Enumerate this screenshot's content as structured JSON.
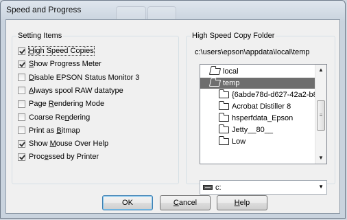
{
  "window": {
    "title": "Speed and Progress"
  },
  "settings": {
    "legend": "Setting Items",
    "items": [
      {
        "pre": "",
        "key": "H",
        "post": "igh Speed Copies",
        "checked": true,
        "focused": true
      },
      {
        "pre": "",
        "key": "S",
        "post": "how Progress Meter",
        "checked": true
      },
      {
        "pre": "",
        "key": "D",
        "post": "isable EPSON Status Monitor 3",
        "checked": false
      },
      {
        "pre": "",
        "key": "A",
        "post": "lways spool RAW datatype",
        "checked": false
      },
      {
        "pre": "Page ",
        "key": "R",
        "post": "endering Mode",
        "checked": false
      },
      {
        "pre": "Coarse Re",
        "key": "n",
        "post": "dering",
        "checked": false
      },
      {
        "pre": "Print as ",
        "key": "B",
        "post": "itmap",
        "checked": false
      },
      {
        "pre": "Show ",
        "key": "M",
        "post": "ouse Over Help",
        "checked": true
      },
      {
        "pre": "Proc",
        "key": "e",
        "post": "ssed by Printer",
        "checked": true
      }
    ]
  },
  "folder": {
    "legend": "High Speed Copy Folder",
    "path": "c:\\users\\epson\\appdata\\local\\temp",
    "tree": [
      {
        "label": "local",
        "icon": "folder-open-icon"
      },
      {
        "label": "temp",
        "icon": "folder-open-icon",
        "selected": true
      },
      {
        "label": "{6abde78d-d627-42a2-b8",
        "icon": "folder-icon"
      },
      {
        "label": "Acrobat Distiller 8",
        "icon": "folder-icon"
      },
      {
        "label": "hsperfdata_Epson",
        "icon": "folder-icon"
      },
      {
        "label": "Jetty__80__",
        "icon": "folder-icon"
      },
      {
        "label": "Low",
        "icon": "folder-icon"
      }
    ],
    "scroll": {
      "up": "▲",
      "down": "▼",
      "grip": "≡"
    },
    "drive": {
      "value": "c:",
      "arrow": "▼"
    }
  },
  "buttons": {
    "ok": {
      "pre": "",
      "key": "",
      "post": "OK"
    },
    "cancel": {
      "pre": "",
      "key": "C",
      "post": "ancel"
    },
    "help": {
      "pre": "",
      "key": "H",
      "post": "elp"
    }
  }
}
